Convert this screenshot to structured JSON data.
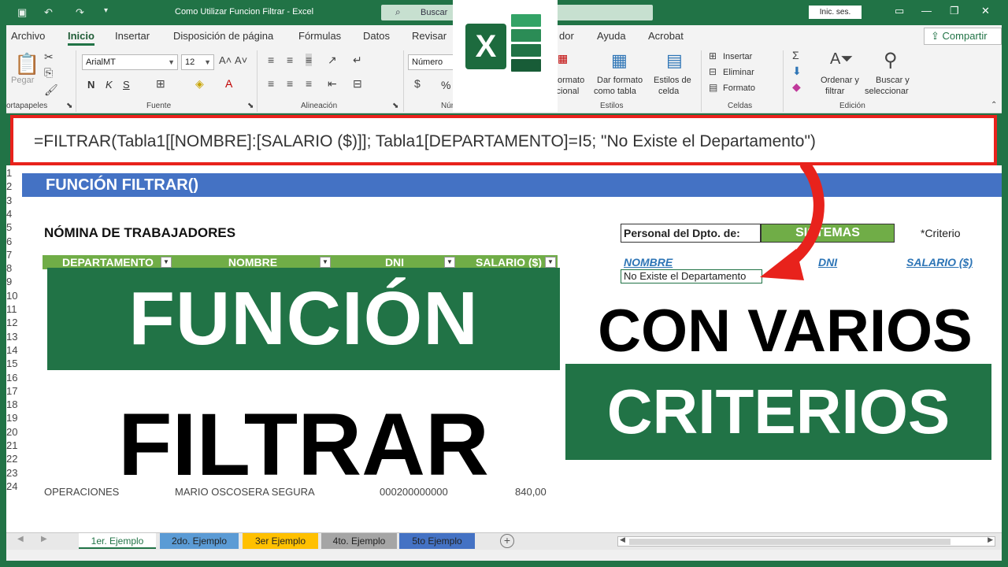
{
  "titlebar": {
    "title": "Como Utilizar Funcion Filtrar  -  Excel",
    "search_label": "Buscar",
    "signin": "Inic. ses."
  },
  "ribbon_tabs": [
    "Archivo",
    "Inicio",
    "Insertar",
    "Disposición de página",
    "Fórmulas",
    "Datos",
    "Revisar",
    "dor",
    "Ayuda",
    "Acrobat"
  ],
  "share_label": "Compartir",
  "clipboard": {
    "paste": "Pegar",
    "group": "ortapapeles"
  },
  "font": {
    "name": "ArialMT",
    "size": "12",
    "group": "Fuente",
    "bold": "N",
    "italic": "K",
    "underline": "S"
  },
  "alignment": {
    "group": "Alineación"
  },
  "number": {
    "format": "Número",
    "group": "Número",
    "percent": "%"
  },
  "styles": {
    "format_conditional": [
      "ormato",
      "dicional"
    ],
    "format_table": [
      "Dar formato",
      "como tabla"
    ],
    "cell_styles": [
      "Estilos de",
      "celda"
    ],
    "group": "Estilos"
  },
  "cells": {
    "insert": "Insertar",
    "delete": "Eliminar",
    "format": "Formato",
    "group": "Celdas"
  },
  "editing": {
    "sort_filter": [
      "Ordenar y",
      "filtrar"
    ],
    "find_select": [
      "Buscar y",
      "seleccionar"
    ],
    "group": "Edición"
  },
  "formula": "=FILTRAR(Tabla1[[NOMBRE]:[SALARIO ($)]]; Tabla1[DEPARTAMENTO]=I5; \"No Existe el Departamento\")",
  "sheet": {
    "banner": "FUNCIÓN FILTRAR()",
    "nomina_title": "NÓMINA DE TRABAJADORES",
    "table_headers": [
      "DEPARTAMENTO",
      "NOMBRE",
      "DNI",
      "SALARIO ($)"
    ],
    "last_row": {
      "dept": "OPERACIONES",
      "name": "MARIO OSCOSERA SEGURA",
      "dni": "000200000000",
      "salary": "840,00"
    },
    "personal_label": "Personal del Dpto. de:",
    "personal_value": "SISTEMAS",
    "criterio": "*Criterio",
    "result_headers": [
      "NOMBRE",
      "DNI",
      "SALARIO ($)"
    ],
    "result_value": "No Existe el Departamento",
    "row_numbers": [
      "1",
      "2",
      "3",
      "4",
      "5",
      "6",
      "7",
      "8",
      "9",
      "10",
      "11",
      "12",
      "13",
      "14",
      "15",
      "16",
      "17",
      "18",
      "19",
      "20",
      "21",
      "22",
      "23",
      "24"
    ]
  },
  "overlay": {
    "line1": "FUNCIÓN",
    "line2": "FILTRAR",
    "line3": "CON VARIOS",
    "line4": "CRITERIOS"
  },
  "sheet_tabs": [
    {
      "label": "1er. Ejemplo",
      "color": "#ffffff",
      "active": true
    },
    {
      "label": "2do. Ejemplo",
      "color": "#5b9bd5"
    },
    {
      "label": "3er Ejemplo",
      "color": "#ffc000"
    },
    {
      "label": "4to. Ejemplo",
      "color": "#a5a5a5"
    },
    {
      "label": "5to Ejemplo",
      "color": "#4472c4"
    }
  ],
  "colors": {
    "excel_green": "#217346",
    "banner_blue": "#4472c4",
    "table_green": "#70ad47",
    "highlight_red": "#e8221c"
  }
}
